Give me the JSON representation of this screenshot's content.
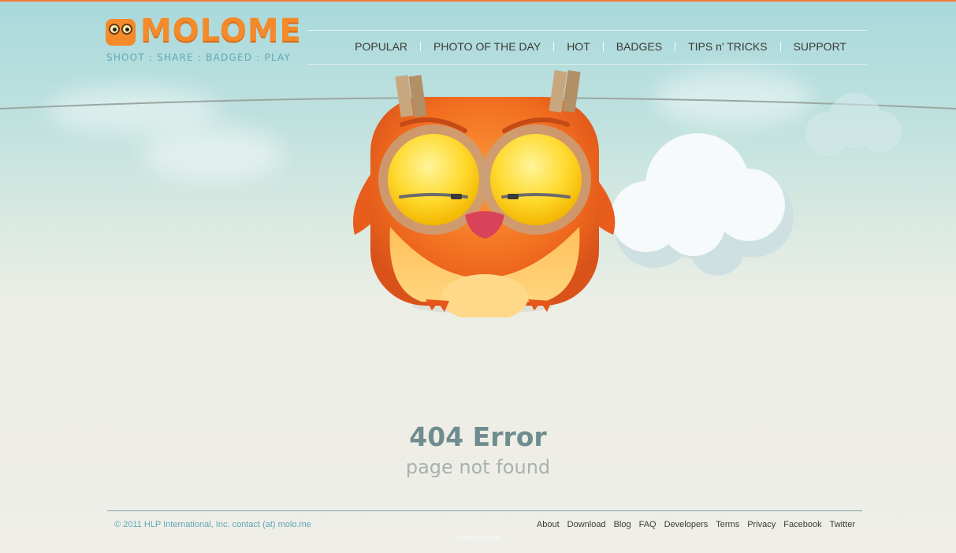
{
  "brand": {
    "name": "MOLOME",
    "tagline": "SHOOT : SHARE : BADGED : PLAY"
  },
  "nav": {
    "items": [
      {
        "label": "POPULAR"
      },
      {
        "label": "PHOTO OF THE DAY"
      },
      {
        "label": "HOT"
      },
      {
        "label": "BADGES"
      },
      {
        "label": "TIPS n' TRICKS"
      },
      {
        "label": "SUPPORT"
      }
    ]
  },
  "error": {
    "title": "404 Error",
    "subtitle": "page not found"
  },
  "footer": {
    "copyright": "© 2011 HLP International, Inc. contact (at) molo.me",
    "links": [
      {
        "label": "About"
      },
      {
        "label": "Download"
      },
      {
        "label": "Blog"
      },
      {
        "label": "FAQ"
      },
      {
        "label": "Developers"
      },
      {
        "label": "Terms"
      },
      {
        "label": "Privacy"
      },
      {
        "label": "Facebook"
      },
      {
        "label": "Twitter"
      }
    ],
    "watermark": "outlasto.com"
  },
  "colors": {
    "accent_orange": "#f48a2a",
    "tagline_blue": "#5fa7b5",
    "error_title": "#6f8c8e",
    "error_sub": "#a9b2ae"
  },
  "icons": {
    "mascot": "owl-mascot-icon",
    "logo": "owl-logo-icon",
    "cloud": "cloud-icon"
  }
}
